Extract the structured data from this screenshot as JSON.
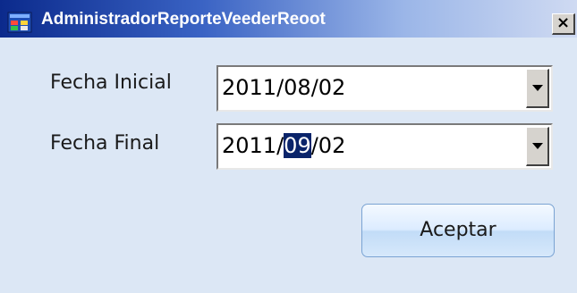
{
  "window": {
    "title": "AdministradorReporteVeederReoot",
    "close_glyph": "×"
  },
  "form": {
    "start_label": "Fecha Inicial",
    "start_value": "2011/08/02",
    "end_label": "Fecha Final",
    "end_value_prefix": "2011/",
    "end_value_selected": "09",
    "end_value_suffix": "/02",
    "accept_label": "Aceptar"
  },
  "icons": {
    "app": "app-window-icon",
    "close": "close-icon",
    "dropdown": "chevron-down-icon"
  },
  "colors": {
    "titlebar_start": "#0b2a8c",
    "client_bg": "#dce7f5",
    "selection_bg": "#0a246a"
  }
}
